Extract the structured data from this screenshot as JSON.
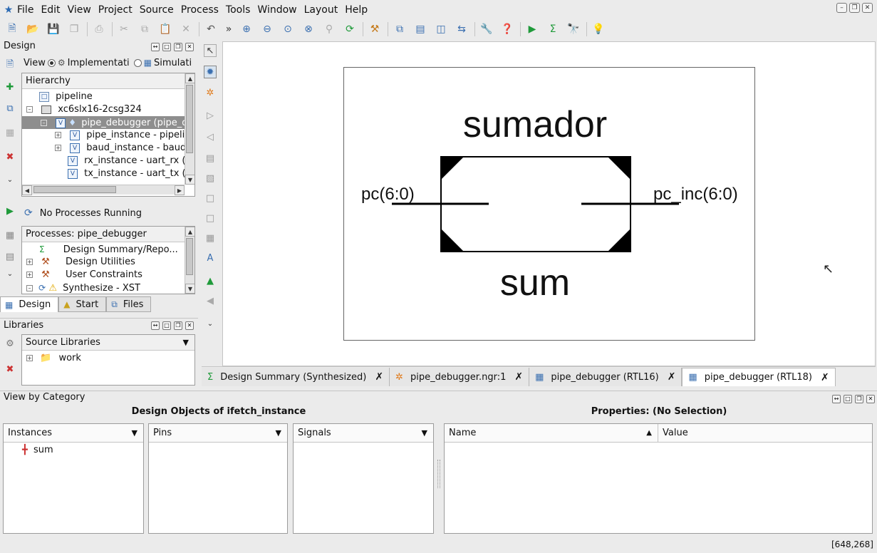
{
  "menubar": {
    "items": [
      "File",
      "Edit",
      "View",
      "Project",
      "Source",
      "Process",
      "Tools",
      "Window",
      "Layout",
      "Help"
    ]
  },
  "toolbar": {
    "icons": [
      "new-file-icon",
      "open-file-icon",
      "save-icon",
      "save-all-icon",
      "print-icon",
      "cut-icon",
      "copy-icon",
      "paste-icon",
      "delete-icon",
      "undo-icon",
      "more-icon",
      "zoom-in-icon",
      "zoom-out-icon",
      "zoom-fit-icon",
      "zoom-full-icon",
      "zoom-select-icon",
      "refresh-icon",
      "hammer-icon",
      "cascade-icon",
      "tile-horizontal-icon",
      "tile-vertical-icon",
      "swap-window-icon",
      "wrench-icon",
      "help-icon",
      "run-icon",
      "sigma-icon",
      "telescope-icon",
      "lightbulb-icon"
    ]
  },
  "design_panel": {
    "title": "Design",
    "view_label": "View",
    "impl_label": "Implementati",
    "sim_label": "Simulati",
    "hierarchy_header": "Hierarchy",
    "tree": [
      {
        "label": "pipeline",
        "indent": 0
      },
      {
        "label": "xc6slx16-2csg324",
        "indent": 0
      },
      {
        "label": "pipe_debugger (pipe_d",
        "indent": 1
      },
      {
        "label": "pipe_instance - pipelin",
        "indent": 2
      },
      {
        "label": "baud_instance - baud",
        "indent": 2
      },
      {
        "label": "rx_instance - uart_rx (",
        "indent": 2
      },
      {
        "label": "tx_instance - uart_tx (",
        "indent": 2
      }
    ],
    "status": "No Processes Running",
    "processes_header": "Processes: pipe_debugger",
    "processes": [
      {
        "label": "Design Summary/Repo...",
        "icon": "sigma-icon"
      },
      {
        "label": "Design Utilities",
        "icon": "tools-icon"
      },
      {
        "label": "User Constraints",
        "icon": "tools-icon"
      },
      {
        "label": "Synthesize - XST",
        "icon": "warning-icon"
      }
    ],
    "tabs": [
      "Design",
      "Start",
      "Files"
    ]
  },
  "libraries_panel": {
    "title": "Libraries",
    "dropdown": "Source Libraries",
    "items": [
      "work"
    ]
  },
  "schematic": {
    "block_title": "sumador",
    "instance_name": "sum",
    "input_port": "pc(6:0)",
    "output_port": "pc_inc(6:0)"
  },
  "doc_tabs": [
    {
      "label": "Design Summary (Synthesized)",
      "icon": "sigma-icon",
      "active": false
    },
    {
      "label": "pipe_debugger.ngr:1",
      "icon": "ngr-icon",
      "active": false
    },
    {
      "label": "pipe_debugger (RTL16)",
      "icon": "schematic-icon",
      "active": false
    },
    {
      "label": "pipe_debugger (RTL18)",
      "icon": "schematic-icon",
      "active": true
    }
  ],
  "bottom_panel": {
    "title": "View by Category",
    "objects_header": "Design Objects of ifetch_instance",
    "properties_header": "Properties: (No Selection)",
    "instances_label": "Instances",
    "pins_label": "Pins",
    "signals_label": "Signals",
    "instances": [
      "sum"
    ],
    "name_col": "Name",
    "value_col": "Value"
  },
  "status_bar": {
    "coords": "[648,268]"
  }
}
